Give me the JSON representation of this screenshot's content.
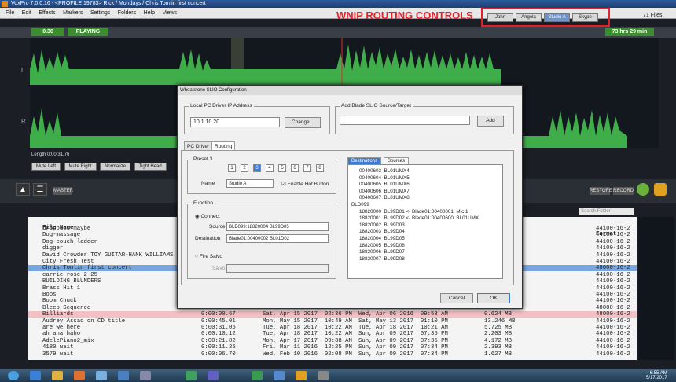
{
  "window": {
    "title": "VoxPro 7.0.0.16 - <PROFILE 19783> Rick / Mondays / Chris Tomlin first concert"
  },
  "menu": [
    "File",
    "Edit",
    "Effects",
    "Markers",
    "Settings",
    "Folders",
    "Help",
    "Views"
  ],
  "annotation": "WNIP ROUTING CONTROLS",
  "routing_tabs": [
    {
      "label": "John",
      "active": false
    },
    {
      "label": "Angela",
      "active": false
    },
    {
      "label": "Studio A",
      "active": true
    },
    {
      "label": "Skype",
      "active": false
    }
  ],
  "files_count": "71 Files",
  "transport": {
    "time": "0.36",
    "state": "PLAYING",
    "remaining": "73 hrs  29 min"
  },
  "channels": {
    "left": "L",
    "right": "R"
  },
  "length": "Length 0:00:31.76",
  "edit_buttons": [
    "Mute Left",
    "Mute Right",
    "Normalize",
    "Tight Head"
  ],
  "side_buttons": {
    "master": "MASTER",
    "restore": "RESTORE",
    "record": "RECORD"
  },
  "search_placeholder": "Search Folder",
  "file_list": {
    "header": {
      "name": "File Name",
      "format": "Format"
    },
    "rows": [
      {
        "name": "dropouts maybe",
        "format": "44100-16-2"
      },
      {
        "name": "Dog-massage",
        "format": "44100-16-2"
      },
      {
        "name": "Dog-couch-ladder",
        "format": "44100-16-2"
      },
      {
        "name": "digger",
        "format": "44100-16-2"
      },
      {
        "name": "David Crowder TOY GUITAR-HANK WILLIAMS",
        "format": "44100-16-2"
      },
      {
        "name": "City Fresh Test",
        "format": "44100-16-2"
      },
      {
        "name": "Chris Tomlin first concert",
        "format": "48000-16-2",
        "selected": true
      },
      {
        "name": "carrie rose 2-25",
        "format": "44100-16-2"
      },
      {
        "name": "BUILDING BLUNDERS",
        "format": "44100-16-2"
      },
      {
        "name": "Brass Hit 1",
        "format": "44100-16-2"
      },
      {
        "name": "Boos",
        "format": "44100-16-2"
      },
      {
        "name": "Boom Chuck",
        "format": "44100-16-2"
      },
      {
        "name": "Bleep Sequence",
        "format": "48000-16-2"
      },
      {
        "name": "Billiards",
        "length": "0:00:00.67",
        "created": "Sat, Apr 15 2017  02:36 PM",
        "modified": "Wed, Apr 06 2016  09:53 AM",
        "size": "0.624 MB",
        "format": "48000-16-2",
        "highlight": true
      },
      {
        "name": "Audrey Assad on CD title",
        "length": "0:00:45.01",
        "created": "Mon, May 15 2017  10:49 AM",
        "modified": "Sat, May 13 2017  01:10 PM",
        "size": "13.246 MB",
        "format": "44100-16-2"
      },
      {
        "name": "are we here",
        "length": "0:00:31.05",
        "created": "Tue, Apr 18 2017  10:22 AM",
        "modified": "Tue, Apr 18 2017  10:21 AM",
        "size": "5.725 MB",
        "format": "44100-16-2"
      },
      {
        "name": "ah aha haho",
        "length": "0:00:10.12",
        "created": "Tue, Apr 18 2017  10:22 AM",
        "modified": "Sun, Apr 09 2017  07:35 PM",
        "size": "2.203 MB",
        "format": "44100-16-2"
      },
      {
        "name": "AdelePiano2_mix",
        "length": "0:00:21.82",
        "created": "Mon, Apr 17 2017  09:38 AM",
        "modified": "Sun, Apr 09 2017  07:35 PM",
        "size": "4.172 MB",
        "format": "44100-16-2"
      },
      {
        "name": "4180 wait",
        "length": "0:00:11.25",
        "created": "Fri, Mar 11 2016  12:25 PM",
        "modified": "Sun, Apr 09 2017  07:34 PM",
        "size": "2.393 MB",
        "format": "44100-16-2"
      },
      {
        "name": "3579 wait",
        "length": "0:00:06.70",
        "created": "Wed, Feb 10 2016  02:08 PM",
        "modified": "Sun, Apr 09 2017  07:34 PM",
        "size": "1.627 MB",
        "format": "44100-16-2"
      }
    ]
  },
  "dialog": {
    "title": "Wheatstone SLIO Configuration",
    "ip_group": "Local PC Driver IP Address",
    "ip_value": "10.1.10.20",
    "change_label": "Change...",
    "blade_group": "Add Blade SLIO Source/Target",
    "add_label": "Add",
    "tabs": [
      {
        "label": "PC Driver"
      },
      {
        "label": "Routing"
      }
    ],
    "preset_group": "Preset 3",
    "preset_buttons": [
      "1",
      "2",
      "3",
      "4",
      "5",
      "6",
      "7",
      "8"
    ],
    "name_label": "Name",
    "name_value": "Studio A",
    "hot_button_label": "Enable Hot Button",
    "function_group": "Function",
    "connect_label": "Connect",
    "source_label": "Source",
    "source_value": "BLD099:18820004  BL99D05",
    "dest_label": "Destination",
    "dest_value": "Blade01:00400002  BL01D02",
    "fire_salvo_label": "Fire Salvo",
    "salvo_label": "Salvo",
    "list_tabs": [
      "Destinations",
      "Sources"
    ],
    "tree": [
      "00400603  BL01UMX4",
      "00400604  BL01UMX5",
      "00400605  BL01UMX6",
      "00400606  BL01UMX7",
      "00400607  BL01UMX8",
      "BLD099",
      "18820000  BL99D01 <- Blade01:00400001  Mic 1",
      "18820001  BL99D02 <- Blade01:00400600  BL01UMX",
      "18820002  BL99D03",
      "18820003  BL99D04",
      "18820004  BL99D05",
      "18820005  BL99D06",
      "18820006  BL99D07",
      "18820007  BL99D08"
    ],
    "cancel_label": "Cancel",
    "ok_label": "OK"
  },
  "tray": {
    "time": "6:55 AM",
    "date": "5/17/2017"
  }
}
